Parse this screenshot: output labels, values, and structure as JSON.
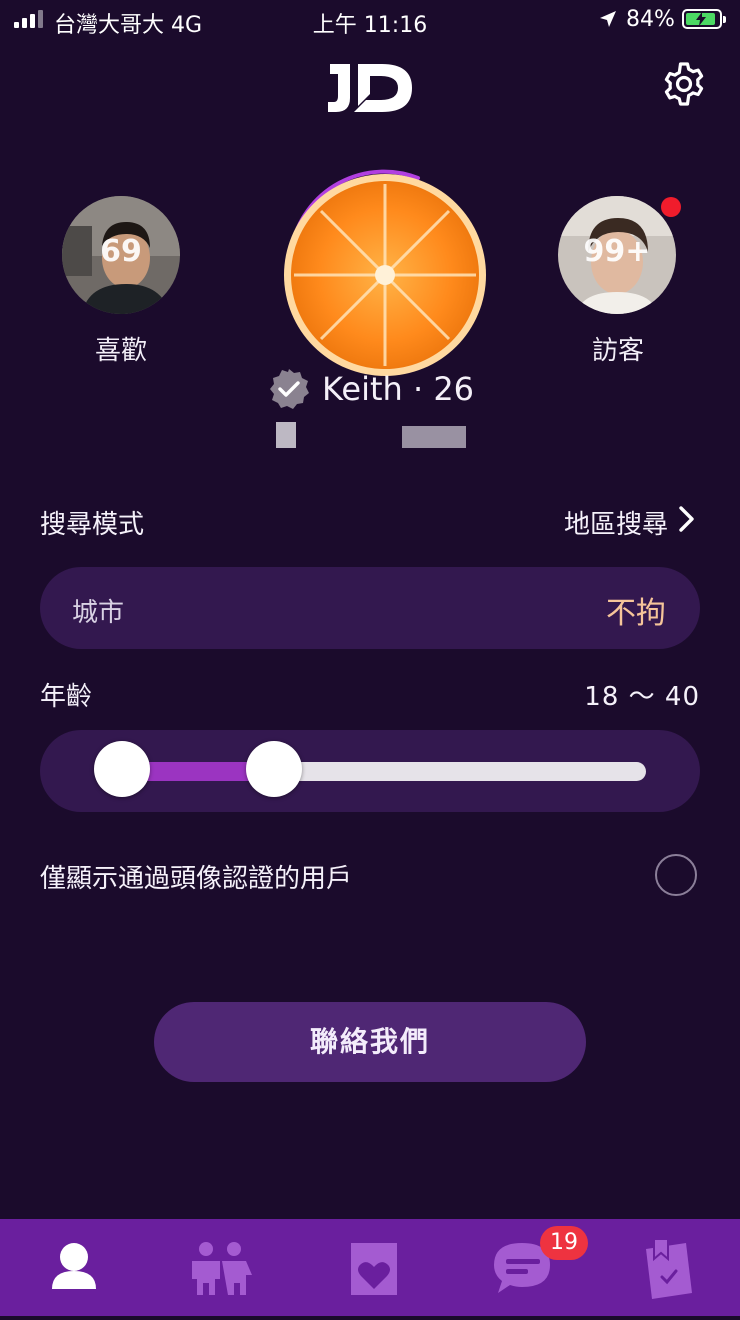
{
  "status_bar": {
    "carrier": "台灣大哥大  4G",
    "time": "上午 11:16",
    "battery": "84%"
  },
  "header": {
    "logo": "JD",
    "settings_icon": "gear-icon"
  },
  "likes": {
    "count": "69",
    "label": "喜歡"
  },
  "visitors": {
    "count": "99+",
    "label": "訪客"
  },
  "profile": {
    "name_line": "Keith · 26",
    "verified_icon": "verified-check-icon"
  },
  "search_mode": {
    "label": "搜尋模式",
    "value": "地區搜尋"
  },
  "city": {
    "label": "城市",
    "value": "不拘"
  },
  "age": {
    "label": "年齡",
    "value": "18 ～ 40",
    "min": 18,
    "max": 40
  },
  "verified_only": {
    "label": "僅顯示通過頭像認證的用戶",
    "checked": false
  },
  "contact": {
    "label": "聯絡我們"
  },
  "tabbar": {
    "tabs": [
      {
        "icon": "profile-icon",
        "active": true
      },
      {
        "icon": "couple-icon",
        "active": false
      },
      {
        "icon": "heart-card-icon",
        "active": false
      },
      {
        "icon": "chat-icon",
        "active": false,
        "badge": "19"
      },
      {
        "icon": "saved-list-icon",
        "active": false
      }
    ]
  },
  "colors": {
    "background": "#1b0b2c",
    "card": "#33184f",
    "accent": "#9b34c1",
    "tabbar": "#6a1f9e",
    "badge": "#ee3340",
    "city_value": "#f6c59a"
  }
}
